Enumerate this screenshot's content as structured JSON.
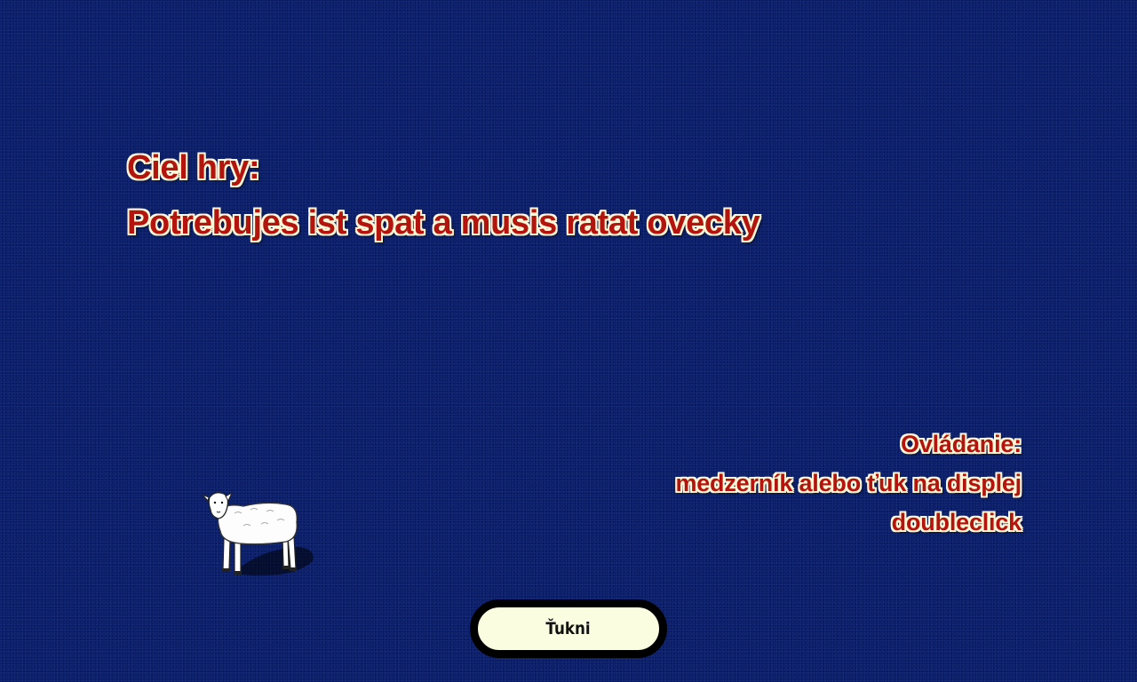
{
  "goal": {
    "heading": "Ciel hry:",
    "text": "Potrebujes ist spat a musis ratat ovecky"
  },
  "controls": {
    "heading": "Ovládanie:",
    "line1": "medzerník alebo ťuk na displej",
    "line2": "doubleclick"
  },
  "sprite": {
    "icon": "sheep-icon"
  },
  "tap_button": {
    "label": "Ťukni"
  },
  "colors": {
    "background": "#0a1f6b",
    "text": "#b3140e",
    "text_outline": "#fff8d8",
    "button_fill": "#fbfde0",
    "button_border": "#000000"
  }
}
